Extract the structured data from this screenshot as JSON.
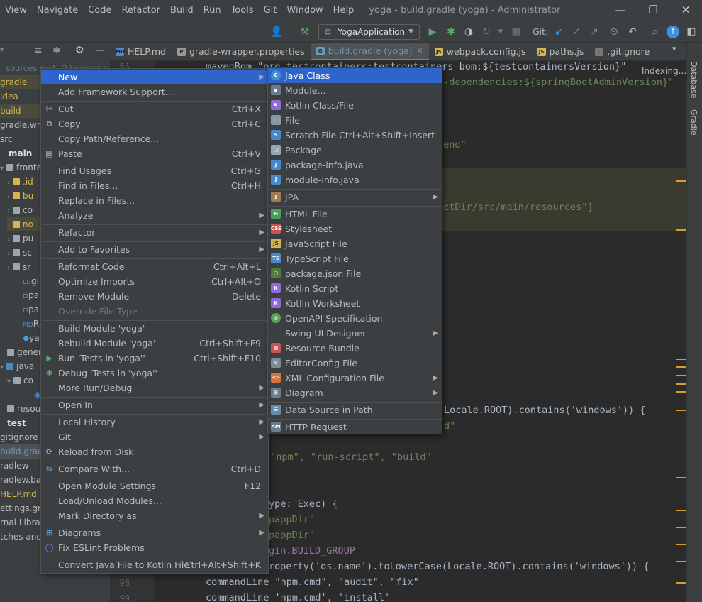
{
  "menubar": {
    "items": [
      "View",
      "Navigate",
      "Code",
      "Refactor",
      "Build",
      "Run",
      "Tools",
      "Git",
      "Window",
      "Help"
    ],
    "title": "yoga - build.gradle (yoga) - Administrator"
  },
  "toolbar": {
    "run_config": "YogaApplication",
    "git_label": "Git:"
  },
  "project": {
    "head_hint": "sources root, D:\\workspac",
    "rows": [
      {
        "text": "gradle"
      },
      {
        "text": "idea"
      },
      {
        "text": "build"
      },
      {
        "text": "gradle.wrapp"
      },
      {
        "text": "src"
      },
      {
        "text": "main"
      },
      {
        "text": "fronte"
      },
      {
        "text": ".id"
      },
      {
        "text": "bu"
      },
      {
        "text": "co"
      },
      {
        "text": "no"
      },
      {
        "text": "pu"
      },
      {
        "text": "sc"
      },
      {
        "text": "sr"
      },
      {
        "text": ".gi"
      },
      {
        "text": "pa"
      },
      {
        "text": "pa"
      },
      {
        "text": "RE"
      },
      {
        "text": "ya"
      },
      {
        "text": "gener"
      },
      {
        "text": "java"
      },
      {
        "text": "co"
      },
      {
        "text": ""
      },
      {
        "text": "resou"
      },
      {
        "text": "test"
      },
      {
        "text": "gitignore"
      },
      {
        "text": "build.gradle"
      },
      {
        "text": "radlew"
      },
      {
        "text": "radlew.bat"
      },
      {
        "text": "HELP.md"
      },
      {
        "text": "ettings.grad"
      },
      {
        "text": "rnal Librarie"
      },
      {
        "text": "tches and C"
      }
    ]
  },
  "tabs": [
    {
      "label": "HELP.md",
      "icon": "MD"
    },
    {
      "label": "gradle-wrapper.properties",
      "icon": "P"
    },
    {
      "label": "build.gradle (yoga)",
      "icon": "G"
    },
    {
      "label": "webpack.config.js",
      "icon": "JS"
    },
    {
      "label": "paths.js",
      "icon": "JS"
    },
    {
      "label": ".gitignore",
      "icon": "."
    }
  ],
  "editor": {
    "indexing": "Indexing...",
    "line_numbers": [
      "65",
      "98",
      "99"
    ],
    "code": [
      "mavenBom \"org.testcontainers:testcontainers-bom:${testcontainersVersion}\"",
      "n-dependencies:${springBootAdminVersion}\"",
      "tend\"",
      "ectDir/src/main/resources\"]",
      "Locale.ROOT).contains('windows')) {",
      "d\"",
      " \"npm\", \"run-script\", \"build\"",
      "ype: Exec) {",
      "pappDir\"",
      "pappDir\"",
      "gin.BUILD_GROUP",
      "roperty('os.name').toLowerCase(Locale.ROOT).contains('windows')) {",
      "commandLine \"npm.cmd\", \"audit\", \"fix\"",
      "commandLine 'npm.cmd', 'install'"
    ]
  },
  "rightbar": {
    "database": "Database",
    "gradle": "Gradle"
  },
  "context_menu": {
    "items": [
      {
        "label": "New",
        "shortcut": "",
        "sub": true
      },
      {
        "label": "Add Framework Support...",
        "shortcut": ""
      },
      {
        "label": "Cut",
        "shortcut": "Ctrl+X"
      },
      {
        "label": "Copy",
        "shortcut": "Ctrl+C"
      },
      {
        "label": "Copy Path/Reference...",
        "shortcut": ""
      },
      {
        "label": "Paste",
        "shortcut": "Ctrl+V"
      },
      {
        "label": "Find Usages",
        "shortcut": "Ctrl+G"
      },
      {
        "label": "Find in Files...",
        "shortcut": "Ctrl+H"
      },
      {
        "label": "Replace in Files...",
        "shortcut": ""
      },
      {
        "label": "Analyze",
        "shortcut": "",
        "sub": true
      },
      {
        "label": "Refactor",
        "shortcut": "",
        "sub": true
      },
      {
        "label": "Add to Favorites",
        "shortcut": "",
        "sub": true
      },
      {
        "label": "Reformat Code",
        "shortcut": "Ctrl+Alt+L"
      },
      {
        "label": "Optimize Imports",
        "shortcut": "Ctrl+Alt+O"
      },
      {
        "label": "Remove Module",
        "shortcut": "Delete"
      },
      {
        "label": "Override File Type",
        "shortcut": ""
      },
      {
        "label": "Build Module 'yoga'",
        "shortcut": ""
      },
      {
        "label": "Rebuild Module 'yoga'",
        "shortcut": "Ctrl+Shift+F9"
      },
      {
        "label": "Run 'Tests in 'yoga''",
        "shortcut": "Ctrl+Shift+F10"
      },
      {
        "label": "Debug 'Tests in 'yoga''",
        "shortcut": ""
      },
      {
        "label": "More Run/Debug",
        "shortcut": "",
        "sub": true
      },
      {
        "label": "Open In",
        "shortcut": "",
        "sub": true
      },
      {
        "label": "Local History",
        "shortcut": "",
        "sub": true
      },
      {
        "label": "Git",
        "shortcut": "",
        "sub": true
      },
      {
        "label": "Reload from Disk",
        "shortcut": ""
      },
      {
        "label": "Compare With...",
        "shortcut": "Ctrl+D"
      },
      {
        "label": "Open Module Settings",
        "shortcut": "F12"
      },
      {
        "label": "Load/Unload Modules...",
        "shortcut": ""
      },
      {
        "label": "Mark Directory as",
        "shortcut": "",
        "sub": true
      },
      {
        "label": "Diagrams",
        "shortcut": "",
        "sub": true
      },
      {
        "label": "Fix ESLint Problems",
        "shortcut": ""
      },
      {
        "label": "Convert Java File to Kotlin File",
        "shortcut": "Ctrl+Alt+Shift+K"
      }
    ]
  },
  "new_submenu": {
    "items": [
      {
        "label": "Java Class",
        "shortcut": ""
      },
      {
        "label": "Module...",
        "shortcut": ""
      },
      {
        "label": "Kotlin Class/File",
        "shortcut": ""
      },
      {
        "label": "File",
        "shortcut": ""
      },
      {
        "label": "Scratch File",
        "shortcut": "Ctrl+Alt+Shift+Insert"
      },
      {
        "label": "Package",
        "shortcut": ""
      },
      {
        "label": "package-info.java",
        "shortcut": ""
      },
      {
        "label": "module-info.java",
        "shortcut": ""
      },
      {
        "label": "JPA",
        "shortcut": "",
        "sub": true
      },
      {
        "label": "HTML File",
        "shortcut": ""
      },
      {
        "label": "Stylesheet",
        "shortcut": ""
      },
      {
        "label": "JavaScript File",
        "shortcut": ""
      },
      {
        "label": "TypeScript File",
        "shortcut": ""
      },
      {
        "label": "package.json File",
        "shortcut": ""
      },
      {
        "label": "Kotlin Script",
        "shortcut": ""
      },
      {
        "label": "Kotlin Worksheet",
        "shortcut": ""
      },
      {
        "label": "OpenAPI Specification",
        "shortcut": ""
      },
      {
        "label": "Swing UI Designer",
        "shortcut": "",
        "sub": true
      },
      {
        "label": "Resource Bundle",
        "shortcut": ""
      },
      {
        "label": "EditorConfig File",
        "shortcut": ""
      },
      {
        "label": "XML Configuration File",
        "shortcut": "",
        "sub": true
      },
      {
        "label": "Diagram",
        "shortcut": "",
        "sub": true
      },
      {
        "label": "Data Source in Path",
        "shortcut": ""
      },
      {
        "label": "HTTP Request",
        "shortcut": ""
      }
    ]
  }
}
